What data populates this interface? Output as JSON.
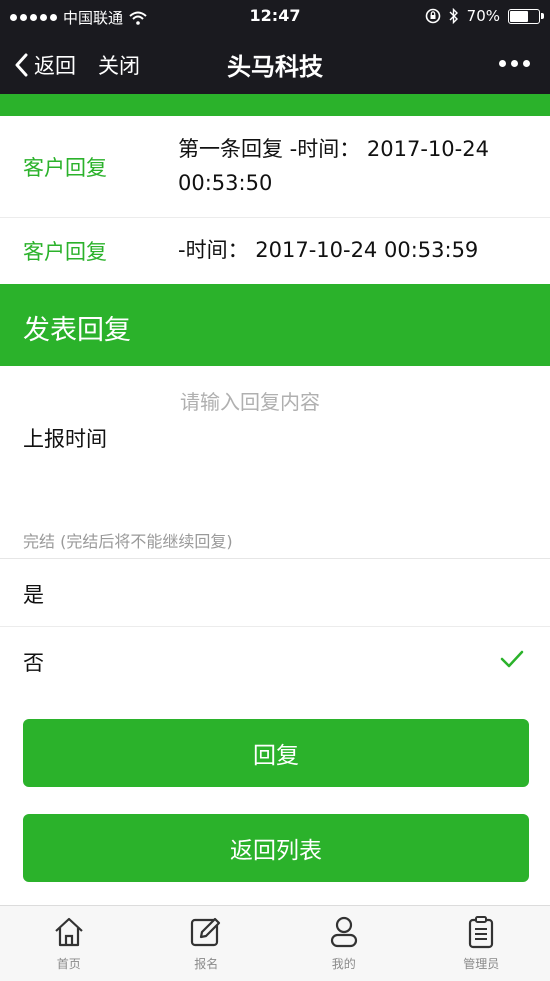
{
  "status_bar": {
    "carrier": "中国联通",
    "time": "12:47",
    "battery": "70%",
    "battery_level": 0.7
  },
  "nav": {
    "back_label": "返回",
    "close_label": "关闭",
    "title": "头马科技"
  },
  "replies": [
    {
      "author": "客户回复",
      "content": "第一条回复 -时间： 2017-10-24 00:53:50"
    },
    {
      "author": "客户回复",
      "content": "-时间： 2017-10-24 00:53:59"
    }
  ],
  "form": {
    "section_title": "发表回复",
    "reply_placeholder": "请输入回复内容",
    "report_time_label": "上报时间",
    "finish_label": "完结 (完结后将不能继续回复)",
    "options": [
      {
        "label": "是",
        "selected": false
      },
      {
        "label": "否",
        "selected": true
      }
    ],
    "reply_button": "回复",
    "back_list_button": "返回列表"
  },
  "tabbar": {
    "items": [
      {
        "label": "首页",
        "icon": "home-icon"
      },
      {
        "label": "报名",
        "icon": "edit-icon"
      },
      {
        "label": "我的",
        "icon": "user-icon"
      },
      {
        "label": "管理员",
        "icon": "clipboard-icon"
      }
    ]
  },
  "colors": {
    "accent": "#2bb22b",
    "nav_bg": "#1a1a1f"
  }
}
